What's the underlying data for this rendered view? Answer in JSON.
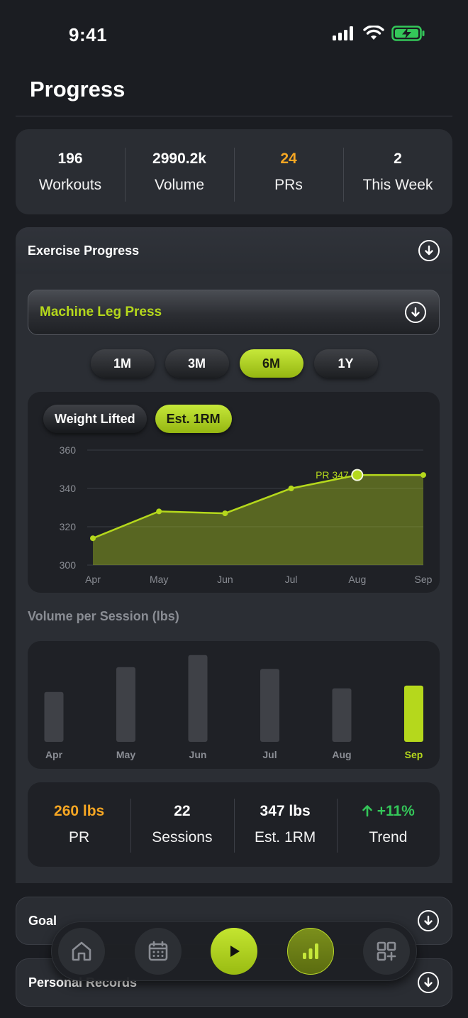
{
  "status_bar": {
    "time": "9:41"
  },
  "page": {
    "title": "Progress"
  },
  "stats": [
    {
      "value": "196",
      "label": "Workouts",
      "color": "#ffffff"
    },
    {
      "value": "2990.2k",
      "label": "Volume",
      "color": "#ffffff"
    },
    {
      "value": "24",
      "label": "PRs",
      "color": "#f5a623"
    },
    {
      "value": "2",
      "label": "This Week",
      "color": "#ffffff"
    }
  ],
  "exercise_progress": {
    "title": "Exercise Progress",
    "selected_exercise": "Machine Leg Press",
    "ranges": [
      {
        "label": "1M",
        "active": false
      },
      {
        "label": "3M",
        "active": false
      },
      {
        "label": "6M",
        "active": true
      },
      {
        "label": "1Y",
        "active": false
      }
    ],
    "metrics": [
      {
        "label": "Weight Lifted",
        "active": false
      },
      {
        "label": "Est. 1RM",
        "active": true
      }
    ],
    "volume_title": "Volume per Session (lbs)",
    "summary": [
      {
        "value": "260 lbs",
        "label": "PR",
        "color": "#f5a623"
      },
      {
        "value": "22",
        "label": "Sessions",
        "color": "#ffffff"
      },
      {
        "value": "347 lbs",
        "label": "Est. 1RM",
        "color": "#ffffff"
      },
      {
        "value": "+11%",
        "label": "Trend",
        "color": "#34c759",
        "icon": "arrow-up-icon"
      }
    ]
  },
  "chart_data": [
    {
      "type": "area",
      "categories": [
        "Apr",
        "May",
        "Jun",
        "Jul",
        "Aug",
        "Sep"
      ],
      "values": [
        314,
        328,
        327,
        340,
        347,
        347
      ],
      "ylim": [
        300,
        360
      ],
      "yticks": [
        "300",
        "320",
        "340",
        "360"
      ],
      "annotation": {
        "text": "PR 347",
        "category": "Aug",
        "value": 347
      },
      "grid": true,
      "color": "#b5d81c"
    },
    {
      "type": "bar",
      "categories": [
        "Apr",
        "May",
        "Jun",
        "Jul",
        "Aug",
        "Sep"
      ],
      "values": [
        54,
        81,
        94,
        79,
        58,
        61
      ],
      "highlight": "Sep",
      "highlight_color": "#b5d81c",
      "bar_color": "#3f4147"
    }
  ],
  "sections": [
    {
      "title": "Goal"
    },
    {
      "title": "Personal Records"
    }
  ],
  "nav": [
    {
      "name": "home-icon"
    },
    {
      "name": "calendar-icon"
    },
    {
      "name": "play-icon"
    },
    {
      "name": "stats-icon"
    },
    {
      "name": "add-widget-icon"
    }
  ],
  "colors": {
    "accent": "#b5d81c",
    "pr_orange": "#f5a623",
    "trend_green": "#34c759",
    "background": "#1b1d22"
  }
}
